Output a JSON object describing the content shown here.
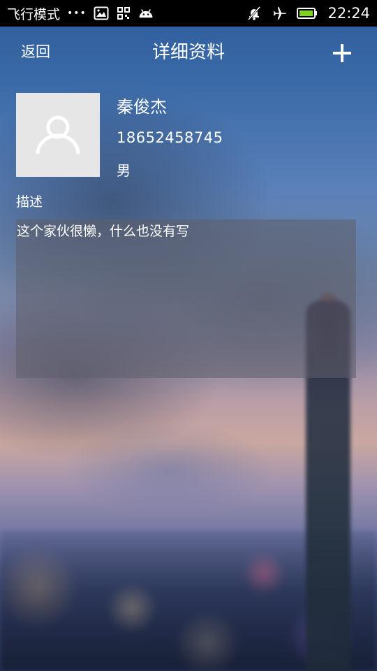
{
  "status_bar": {
    "left_text": "飞行模式",
    "dots": "•••",
    "icons": [
      "image-icon",
      "qr-grid-icon",
      "android-icon"
    ],
    "right_icons": [
      "notification-muted-icon",
      "airplane-icon",
      "battery-icon"
    ],
    "time": "22:24"
  },
  "header": {
    "back_label": "返回",
    "title": "详细资料",
    "add_icon": "plus-icon"
  },
  "profile": {
    "avatar_icon": "user-avatar-icon",
    "name": "秦俊杰",
    "phone": "18652458745",
    "gender": "男"
  },
  "description": {
    "label": "描述",
    "text": "这个家伙很懒，什么也没有写"
  },
  "colors": {
    "status_bar_bg": "#000000",
    "battery": "#7ed321",
    "avatar_bg": "#e6e6e6",
    "text": "#ffffff"
  }
}
